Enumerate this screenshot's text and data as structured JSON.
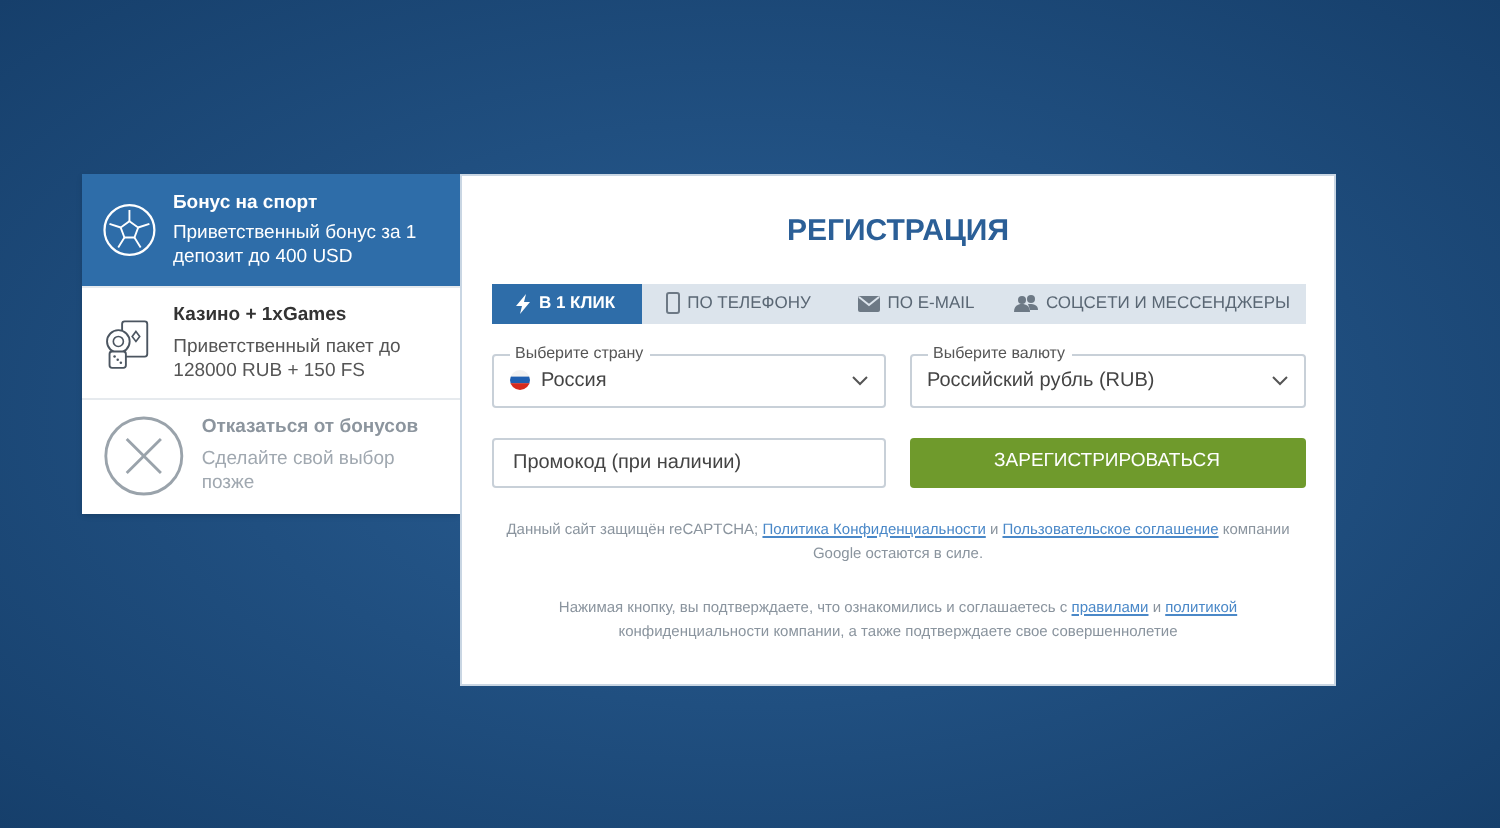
{
  "bonuses": [
    {
      "kind": "sport",
      "title": "Бонус на спорт",
      "subtitle": "Приветственный бонус за 1 депозит до 400 USD",
      "selected": true
    },
    {
      "kind": "casino",
      "title": "Казино + 1xGames",
      "subtitle": "Приветственный пакет до 128000 RUB + 150 FS",
      "selected": false
    },
    {
      "kind": "decline",
      "title": "Отказаться от бонусов",
      "subtitle": "Сделайте свой выбор позже",
      "selected": false
    }
  ],
  "form": {
    "title": "РЕГИСТРАЦИЯ",
    "tabs": [
      {
        "kind": "bolt",
        "label": "В 1 КЛИК",
        "selected": true
      },
      {
        "kind": "phone",
        "label": "ПО ТЕЛЕФОНУ",
        "selected": false
      },
      {
        "kind": "mail",
        "label": "ПО E-MAIL",
        "selected": false
      },
      {
        "kind": "people",
        "label": "СОЦСЕТИ И МЕССЕНДЖЕРЫ",
        "selected": false
      }
    ],
    "country": {
      "label": "Выберите страну",
      "value": "Россия"
    },
    "currency": {
      "label": "Выберите валюту",
      "value": "Российский рубль (RUB)"
    },
    "promo": {
      "placeholder": "Промокод (при наличии)"
    },
    "submit": "ЗАРЕГИСТРИРОВАТЬСЯ",
    "notes": [
      [
        {
          "kind": "text",
          "text": "Данный сайт защищён reCAPTCHA; "
        },
        {
          "kind": "link",
          "text": "Политика Конфиденциальности"
        },
        {
          "kind": "text",
          "text": " и "
        },
        {
          "kind": "link",
          "text": "Пользовательское соглашение"
        },
        {
          "kind": "text",
          "text": " компании Google остаются в силе."
        }
      ],
      [
        {
          "kind": "text",
          "text": "Нажимая кнопку, вы подтверждаете, что ознакомились и соглашаетесь с "
        },
        {
          "kind": "link",
          "text": "правилами"
        },
        {
          "kind": "text",
          "text": " и "
        },
        {
          "kind": "link",
          "text": "политикой"
        },
        {
          "kind": "text",
          "text": " конфиденциальности компании, а также подтверждаете свое совершеннолетие"
        }
      ]
    ]
  }
}
